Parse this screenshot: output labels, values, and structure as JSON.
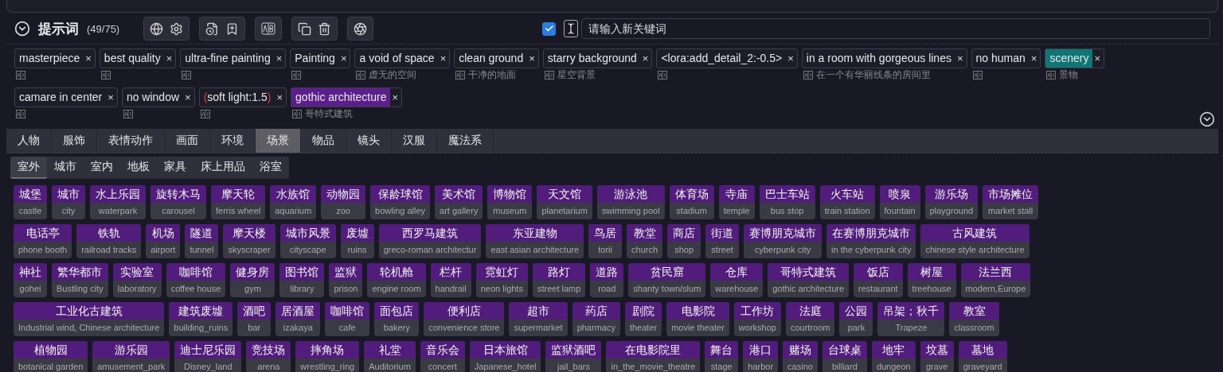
{
  "prompt_panel": {
    "title": "提示词",
    "count": "(49/75)",
    "auto_translate": {
      "checked": true
    },
    "keyword_input": {
      "placeholder": "请输入新关键词"
    }
  },
  "tags": [
    {
      "text": "masterpiece",
      "remove": "×",
      "weighted": false
    },
    {
      "text": "best quality",
      "remove": "×",
      "weighted": false
    },
    {
      "text": "ultra-fine painting",
      "remove": "×",
      "weighted": false
    },
    {
      "text": "Painting",
      "remove": "×",
      "weighted": false
    },
    {
      "text": "a void of space",
      "remove": "×",
      "translation": "虚无的空间",
      "weighted": false
    },
    {
      "text": "clean ground",
      "remove": "×",
      "translation": "干净的地面",
      "weighted": false
    },
    {
      "text": "starry background",
      "remove": "×",
      "translation": "星空背景",
      "weighted": false
    },
    {
      "text": "<lora:add_detail_2:-0.5>",
      "remove": "×",
      "weighted": false
    },
    {
      "text": "in a room with gorgeous lines",
      "remove": "×",
      "translation": "在一个有华丽线条的房间里",
      "weighted": false
    },
    {
      "text": "no human",
      "remove": "×",
      "weighted": false
    },
    {
      "text": "scenery",
      "remove": "×",
      "translation": "景物",
      "weighted": false,
      "color": "#0f7575"
    },
    {
      "text": "camare in center",
      "remove": "×",
      "weighted": false
    },
    {
      "text": "no window",
      "remove": "×",
      "weighted": false
    },
    {
      "text": "(soft light:1.5)",
      "remove": "×",
      "weighted": true
    },
    {
      "text": "gothic architecture",
      "remove": "×",
      "translation": "哥特式建筑",
      "weighted": false,
      "color": "#5b1f8a"
    }
  ],
  "category_tabs": [
    {
      "label": "人物",
      "selected": false
    },
    {
      "label": "服饰",
      "selected": false
    },
    {
      "label": "表情动作",
      "selected": false
    },
    {
      "label": "画面",
      "selected": false
    },
    {
      "label": "环境",
      "selected": false
    },
    {
      "label": "场景",
      "selected": true
    },
    {
      "label": "物品",
      "selected": false
    },
    {
      "label": "镜头",
      "selected": false
    },
    {
      "label": "汉服",
      "selected": false
    },
    {
      "label": "魔法系",
      "selected": false
    }
  ],
  "subcategory_tabs": [
    {
      "label": "室外",
      "selected": true
    },
    {
      "label": "城市",
      "selected": false
    },
    {
      "label": "室内",
      "selected": false
    },
    {
      "label": "地板",
      "selected": false
    },
    {
      "label": "家具",
      "selected": false
    },
    {
      "label": "床上用品",
      "selected": false
    },
    {
      "label": "浴室",
      "selected": false
    }
  ],
  "keyword_rows": [
    [
      {
        "cn": "城堡",
        "en": "castle"
      },
      {
        "cn": "城市",
        "en": "city"
      },
      {
        "cn": "水上乐园",
        "en": "waterpark"
      },
      {
        "cn": "旋转木马",
        "en": "carousel"
      },
      {
        "cn": "摩天轮",
        "en": "ferris wheel"
      },
      {
        "cn": "水族馆",
        "en": "aquarium"
      },
      {
        "cn": "动物园",
        "en": "zoo"
      },
      {
        "cn": "保龄球馆",
        "en": "bowling alley"
      },
      {
        "cn": "美术馆",
        "en": "art gallery"
      },
      {
        "cn": "博物馆",
        "en": "museum"
      },
      {
        "cn": "天文馆",
        "en": "planetarium"
      },
      {
        "cn": "游泳池",
        "en": "swimming pool"
      },
      {
        "cn": "体育场",
        "en": "stadium"
      },
      {
        "cn": "寺庙",
        "en": "temple"
      },
      {
        "cn": "巴士车站",
        "en": "bus stop"
      },
      {
        "cn": "火车站",
        "en": "train station"
      },
      {
        "cn": "喷泉",
        "en": "fountain"
      },
      {
        "cn": "游乐场",
        "en": "playground"
      },
      {
        "cn": "市场摊位",
        "en": "market stall"
      }
    ],
    [
      {
        "cn": "电话亭",
        "en": "phone booth"
      },
      {
        "cn": "铁轨",
        "en": "railroad tracks"
      },
      {
        "cn": "机场",
        "en": "airport"
      },
      {
        "cn": "隧道",
        "en": "tunnel"
      },
      {
        "cn": "摩天楼",
        "en": "skyscraper"
      },
      {
        "cn": "城市风景",
        "en": "cityscape"
      },
      {
        "cn": "废墟",
        "en": "ruins"
      },
      {
        "cn": "西罗马建筑",
        "en": "greco-roman architectur"
      },
      {
        "cn": "东亚建物",
        "en": "east asian architecture"
      },
      {
        "cn": "鸟居",
        "en": "torii"
      },
      {
        "cn": "教堂",
        "en": "church"
      },
      {
        "cn": "商店",
        "en": "shop"
      },
      {
        "cn": "街道",
        "en": "street"
      },
      {
        "cn": "赛博朋克城市",
        "en": "cyberpunk city"
      },
      {
        "cn": "在赛博朋克城市",
        "en": "in the cyberpunk city"
      },
      {
        "cn": "古风建筑",
        "en": "chinese style architecture"
      }
    ],
    [
      {
        "cn": "神社",
        "en": "gohei"
      },
      {
        "cn": "繁华都市",
        "en": "Bustling city"
      },
      {
        "cn": "实验室",
        "en": "laboratory"
      },
      {
        "cn": "咖啡馆",
        "en": "coffee house"
      },
      {
        "cn": "健身房",
        "en": "gym"
      },
      {
        "cn": "图书馆",
        "en": "library"
      },
      {
        "cn": "监狱",
        "en": "prison"
      },
      {
        "cn": "轮机舱",
        "en": "engine room"
      },
      {
        "cn": "栏杆",
        "en": "handrail"
      },
      {
        "cn": "霓虹灯",
        "en": "neon lights"
      },
      {
        "cn": "路灯",
        "en": "street lamp"
      },
      {
        "cn": "道路",
        "en": "road"
      },
      {
        "cn": "贫民窟",
        "en": "shanty town/slum"
      },
      {
        "cn": "仓库",
        "en": "warehouse"
      },
      {
        "cn": "哥特式建筑",
        "en": "gothic architecture"
      },
      {
        "cn": "饭店",
        "en": "restaurant"
      },
      {
        "cn": "树屋",
        "en": "treehouse"
      },
      {
        "cn": "法兰西",
        "en": "modern,Europe"
      }
    ],
    [
      {
        "cn": "工业化古建筑",
        "en": "Industrial wind, Chinese architecture"
      },
      {
        "cn": "建筑废墟",
        "en": "building_ruins"
      },
      {
        "cn": "酒吧",
        "en": "bar"
      },
      {
        "cn": "居酒屋",
        "en": "izakaya"
      },
      {
        "cn": "咖啡馆",
        "en": "cafe"
      },
      {
        "cn": "面包店",
        "en": "bakery"
      },
      {
        "cn": "便利店",
        "en": "convenience store"
      },
      {
        "cn": "超市",
        "en": "supermarket"
      },
      {
        "cn": "药店",
        "en": "pharmacy"
      },
      {
        "cn": "剧院",
        "en": "theater"
      },
      {
        "cn": "电影院",
        "en": "movie theater"
      },
      {
        "cn": "工作坊",
        "en": "workshop"
      },
      {
        "cn": "法庭",
        "en": "courtroom"
      },
      {
        "cn": "公园",
        "en": "park"
      },
      {
        "cn": "吊架；秋千",
        "en": "Trapeze"
      },
      {
        "cn": "教室",
        "en": "classroom"
      }
    ],
    [
      {
        "cn": "植物园",
        "en": "botanical garden"
      },
      {
        "cn": "游乐园",
        "en": "amusement_park"
      },
      {
        "cn": "迪士尼乐园",
        "en": "Disney_land"
      },
      {
        "cn": "竞技场",
        "en": "arena"
      },
      {
        "cn": "摔角场",
        "en": "wrestling_ring"
      },
      {
        "cn": "礼堂",
        "en": "Auditorium"
      },
      {
        "cn": "音乐会",
        "en": "concert"
      },
      {
        "cn": "日本旅馆",
        "en": "Japanese_hotel"
      },
      {
        "cn": "监狱酒吧",
        "en": "jail_bars"
      },
      {
        "cn": "在电影院里",
        "en": "in_the_movie_theatre"
      },
      {
        "cn": "舞台",
        "en": "stage"
      },
      {
        "cn": "港口",
        "en": "harbor"
      },
      {
        "cn": "赌场",
        "en": "casino"
      },
      {
        "cn": "台球桌",
        "en": "billiard"
      },
      {
        "cn": "地牢",
        "en": "dungeon"
      },
      {
        "cn": "坟墓",
        "en": "grave"
      },
      {
        "cn": "墓地",
        "en": "graveyard"
      }
    ]
  ]
}
